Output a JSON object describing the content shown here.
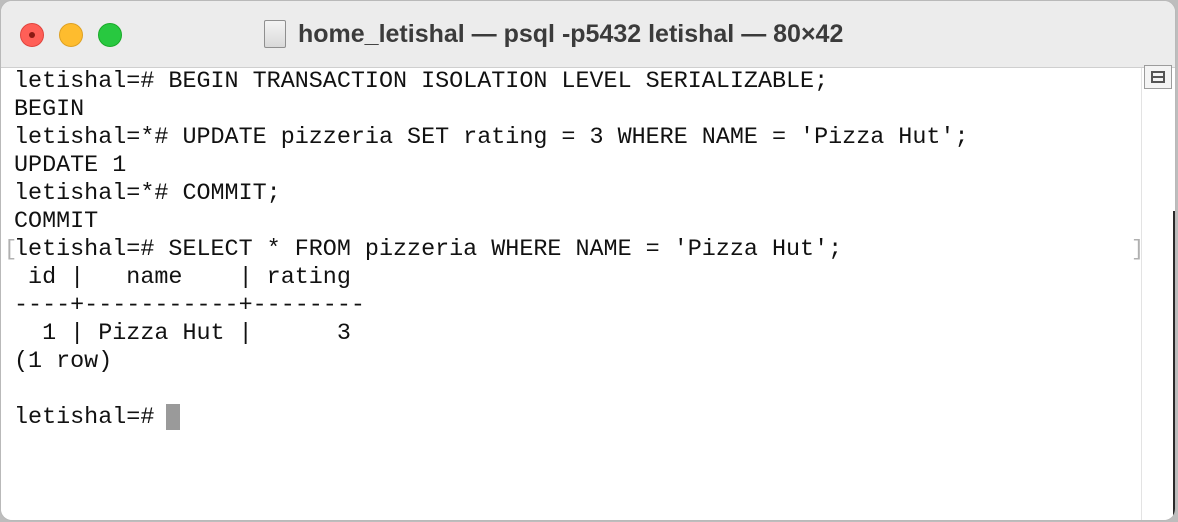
{
  "window": {
    "title": "home_letishal — psql -p5432 letishal — 80×42"
  },
  "terminal": {
    "lines": [
      "letishal=# BEGIN TRANSACTION ISOLATION LEVEL SERIALIZABLE;",
      "BEGIN",
      "letishal=*# UPDATE pizzeria SET rating = 3 WHERE NAME = 'Pizza Hut';",
      "UPDATE 1",
      "letishal=*# COMMIT;",
      "COMMIT",
      "letishal=# SELECT * FROM pizzeria WHERE NAME = 'Pizza Hut';",
      " id |   name    | rating",
      "----+-----------+--------",
      "  1 | Pizza Hut |      3",
      "(1 row)",
      "",
      "letishal=# "
    ],
    "mark_brackets": [
      "[",
      "]"
    ]
  },
  "icons": {
    "close": "close-button-icon",
    "minimize": "minimize-button-icon",
    "zoom": "zoom-button-icon",
    "document": "document-icon",
    "scroll": "scroll-split-icon"
  },
  "colors": {
    "close": "#ff5f57",
    "minimize": "#febc2e",
    "zoom": "#28c840",
    "cursor": "#9a9a9a"
  }
}
